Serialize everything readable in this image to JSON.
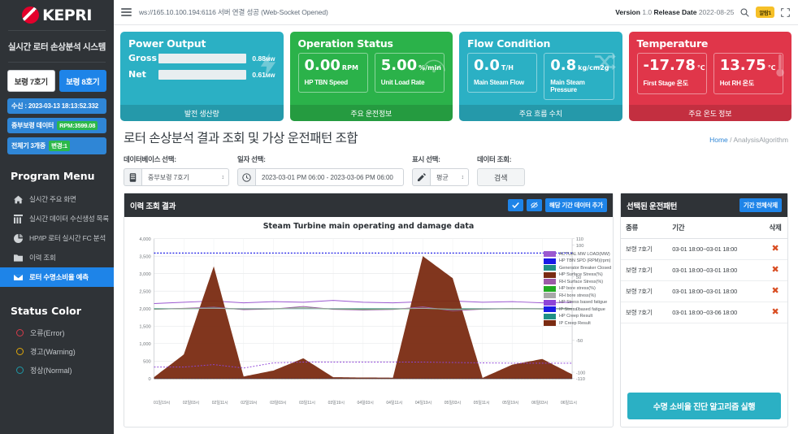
{
  "sidebar": {
    "logo_text": "KEPRI",
    "system_title": "실시간 로터 손상분석 시스템",
    "unit_buttons": [
      {
        "label": "보령 7호기",
        "active": false
      },
      {
        "label": "보령 8호기",
        "active": true
      }
    ],
    "info_pills": [
      {
        "label": "수신 : 2023-03-13 18:13:52.332",
        "tag": ""
      },
      {
        "label": "중부보령 데이터",
        "tag": "RPM:3599.08"
      },
      {
        "label": "전체기 3개중",
        "tag": "변경:1"
      }
    ],
    "menu_head": "Program Menu",
    "menu_items": [
      {
        "label": "실시간 주요 화면",
        "icon": "home-icon",
        "selected": false
      },
      {
        "label": "실시간 데이터 수신생성 목록",
        "icon": "grid-icon",
        "selected": false
      },
      {
        "label": "HP/IP 로터 실시간 FC 분석",
        "icon": "pie-chart-icon",
        "selected": false
      },
      {
        "label": "이력 조회",
        "icon": "folder-icon",
        "selected": false
      },
      {
        "label": "로터 수명소비율 예측",
        "icon": "envelope-icon",
        "selected": true
      }
    ],
    "status_head": "Status Color",
    "status_items": [
      {
        "label": "오류(Error)",
        "color": "#d63b4a"
      },
      {
        "label": "경고(Warning)",
        "color": "#e0a80b"
      },
      {
        "label": "정상(Normal)",
        "color": "#1e9aa8"
      }
    ]
  },
  "topbar": {
    "websocket_text": "ws://165.10.100.194:6116 서버 연결 성공 (Web-Socket Opened)",
    "version_label": "Version",
    "version_value": "1.0",
    "release_label": "Release Date",
    "release_value": "2022-08-25",
    "alarm_badge": "알람1",
    "search_icon": "search-icon",
    "fullscreen_icon": "fullscreen-icon"
  },
  "kpi_cards": [
    {
      "title": "Power Output",
      "footer": "발전 생산량",
      "color": "#2bb0c4",
      "type": "bars",
      "bars": [
        {
          "label": "Gross",
          "value": "0.88",
          "unit": "MW",
          "pct": 0
        },
        {
          "label": "Net",
          "value": "0.61",
          "unit": "MW",
          "pct": 0
        }
      ]
    },
    {
      "title": "Operation Status",
      "footer": "주요 운전정보",
      "color": "#2bb24a",
      "type": "pair",
      "items": [
        {
          "value": "0.00",
          "unit": "RPM",
          "caption": "HP TBN Speed"
        },
        {
          "value": "5.00",
          "unit": "%/min",
          "caption": "Unit Load Rate"
        }
      ]
    },
    {
      "title": "Flow Condition",
      "footer": "주요 흐름 수치",
      "color": "#2bb0c4",
      "type": "pair",
      "items": [
        {
          "value": "0.0",
          "unit": "T/H",
          "caption": "Main Steam Flow"
        },
        {
          "value": "0.8",
          "unit": "kg/cm2g",
          "caption": "Main Steam Pressure"
        }
      ]
    },
    {
      "title": "Temperature",
      "footer": "주요 온도 정보",
      "color": "#e0364a",
      "type": "pair",
      "items": [
        {
          "value": "-17.78",
          "unit": "℃",
          "caption": "First Stage 온도"
        },
        {
          "value": "13.75",
          "unit": "℃",
          "caption": "Hot RH 온도"
        }
      ]
    }
  ],
  "page": {
    "title": "로터 손상분석 결과 조회 및 가상 운전패턴 조합",
    "breadcrumb_home": "Home",
    "breadcrumb_sep": "/",
    "breadcrumb_current": "AnalysisAlgorithm"
  },
  "filters": {
    "db_label": "데이터베이스 선택:",
    "db_value": "중부보령 7호기",
    "date_label": "일자 선택:",
    "date_value": "2023-03-01 PM 06:00 - 2023-03-06 PM 06:00",
    "display_label": "표시 선택:",
    "display_value": "평균",
    "query_label": "데이터 조회:",
    "query_button": "검색"
  },
  "history_panel": {
    "title": "이력 조회 결과",
    "check_icon": "check-icon",
    "hide_icon": "eye-slash-icon",
    "add_button": "해당 기간 데이터 추가"
  },
  "pattern_panel": {
    "title": "선택된 운전패턴",
    "clear_button": "기간 전체삭제",
    "columns": [
      "종류",
      "기간",
      "삭제"
    ],
    "rows": [
      {
        "kind": "보령 7호기",
        "period": "03-01 18:00~03-01 18:00",
        "delete": "✖"
      },
      {
        "kind": "보령 7호기",
        "period": "03-01 18:00~03-01 18:00",
        "delete": "✖"
      },
      {
        "kind": "보령 7호기",
        "period": "03-01 18:00~03-01 18:00",
        "delete": "✖"
      },
      {
        "kind": "보령 7호기",
        "period": "03-01 18:00~03-06 18:00",
        "delete": "✖"
      }
    ],
    "run_button": "수명 소비율 진단 알고리즘 실행"
  },
  "chart_data": {
    "type": "line",
    "title": "Steam Turbine main operating and damage data",
    "xlabel": "",
    "ylabel": "",
    "grid": true,
    "legend_position": "right-inside",
    "ylim": [
      0,
      4000
    ],
    "y_ticks": [
      "0",
      "500",
      "1,000",
      "1,500",
      "2,000",
      "2,500",
      "3,000",
      "3,500",
      "4,000"
    ],
    "y2lim": [
      -110,
      110
    ],
    "y2_ticks": [
      "110",
      "100",
      "50",
      "0",
      "-50",
      "-100",
      "-110"
    ],
    "x": [
      "01일19시",
      "02일03시",
      "02일11시",
      "02일19시",
      "03일03시",
      "03일11시",
      "03일19시",
      "04일03시",
      "04일11시",
      "04일19시",
      "05일03시",
      "05일11시",
      "05일19시",
      "06일03시",
      "06일11시"
    ],
    "series": [
      {
        "name": "ACTUAL MW LOAD(MW)",
        "color": "#9b59d0",
        "axis": "right",
        "values": [
          8,
          10,
          12,
          9,
          11,
          10,
          13,
          10,
          9,
          11,
          12,
          10,
          11,
          9,
          10
        ]
      },
      {
        "name": "HP TBN SPD (RPM)(rpm)",
        "color": "#1a1ae6",
        "axis": "left",
        "values": [
          3590,
          3590,
          3590,
          3590,
          3590,
          3590,
          3590,
          3590,
          3590,
          3590,
          3590,
          3590,
          3590,
          3590,
          3590
        ]
      },
      {
        "name": "Generator Breaker Closed",
        "color": "#1f8f86",
        "axis": "right",
        "values": [
          0,
          0,
          0,
          0,
          0,
          0,
          0,
          0,
          0,
          0,
          0,
          0,
          0,
          0,
          0
        ]
      },
      {
        "name": "HP Surface Stress(%)",
        "color": "#7a2b12",
        "axis": "left",
        "values": [
          40,
          690,
          3210,
          60,
          230,
          580,
          40,
          30,
          25,
          3500,
          2870,
          20,
          400,
          560,
          120
        ]
      },
      {
        "name": "RH Surface Stress(%)",
        "color": "#9d5aa8",
        "axis": "left",
        "values": [
          1980,
          2010,
          2040,
          1970,
          1990,
          2060,
          1980,
          1960,
          1975,
          2050,
          1940,
          1985,
          2000,
          1990,
          2000
        ]
      },
      {
        "name": "HP bore stress(%)",
        "color": "#22aa22",
        "axis": "left",
        "values": [
          1985,
          2000,
          2015,
          1990,
          1995,
          2020,
          1990,
          1980,
          1985,
          2010,
          1975,
          1990,
          2000,
          1995,
          2000
        ]
      },
      {
        "name": "RH bore stress(%)",
        "color": "#a8a8a8",
        "axis": "left",
        "values": [
          1990,
          2000,
          2010,
          1995,
          1998,
          2012,
          1995,
          1988,
          1992,
          2008,
          1985,
          1995,
          2000,
          1998,
          2000
        ]
      },
      {
        "name": "HP Stress based fatigue",
        "color": "#8e44d8",
        "axis": "left",
        "values": [
          330,
          330,
          400,
          300,
          450,
          470,
          470,
          470,
          470,
          470,
          460,
          450,
          440,
          440,
          440
        ]
      },
      {
        "name": "IP Stress based fatigue",
        "color": "#1a1ae6",
        "axis": "left",
        "values": [
          3,
          3,
          3,
          3,
          3,
          3,
          3,
          3,
          3,
          3,
          3,
          3,
          3,
          3,
          3
        ]
      },
      {
        "name": "HP Creep Result",
        "color": "#1f8f86",
        "axis": "left",
        "values": [
          0,
          0,
          0,
          0,
          0,
          0,
          0,
          0,
          0,
          0,
          0,
          0,
          0,
          0,
          0
        ]
      },
      {
        "name": "IP Creep Result",
        "color": "#7a2b12",
        "axis": "left",
        "values": [
          0,
          0,
          0,
          0,
          0,
          0,
          0,
          0,
          0,
          0,
          0,
          0,
          0,
          0,
          0
        ]
      }
    ]
  }
}
